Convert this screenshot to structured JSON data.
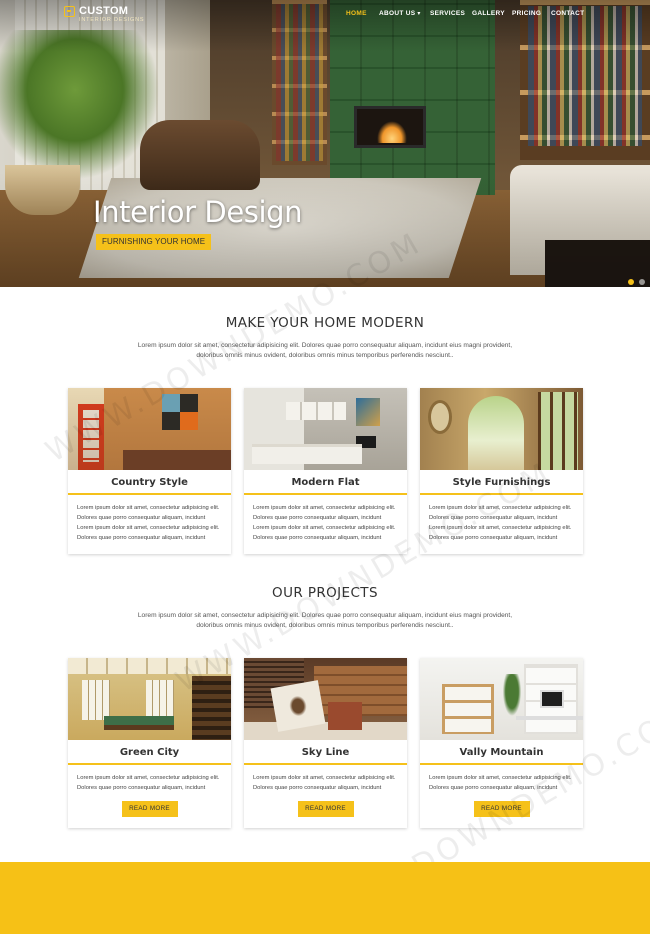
{
  "brand": {
    "name": "CUSTOM",
    "tagline": "INTERIOR DESIGNS",
    "accent_color": "#f5c11a"
  },
  "nav": {
    "items": [
      {
        "label": "HOME",
        "active": true
      },
      {
        "label": "ABOUT US",
        "has_dropdown": true,
        "active": false
      },
      {
        "label": "SERVICES",
        "active": false
      },
      {
        "label": "GALLERY",
        "active": false
      },
      {
        "label": "PRICING",
        "active": false
      },
      {
        "label": "CONTACT",
        "active": false
      }
    ],
    "dropdown_icon": "chevron-down-icon"
  },
  "hero": {
    "title": "Interior Design",
    "button_label": "FURNISHING YOUR HOME",
    "slides": 2,
    "active_slide": 1
  },
  "intro": {
    "title": "MAKE YOUR HOME MODERN",
    "text_line1": "Lorem ipsum dolor sit amet, consectetur adipisicing elit. Dolores quae porro consequatur aliquam, incidunt eius magni provident,",
    "text_line2": "doloribus omnis minus ovident, doloribus omnis minus temporibus perferendis nesciunt.."
  },
  "services": [
    {
      "title": "Country Style",
      "lines": [
        "Lorem ipsum dolor sit amet, consectetur adipisicing elit.",
        "Dolores quae porro consequatur aliquam, incidunt",
        "Lorem ipsum dolor sit amet, consectetur adipisicing elit.",
        "Dolores quae porro consequatur aliquam, incidunt"
      ]
    },
    {
      "title": "Modern Flat",
      "lines": [
        "Lorem ipsum dolor sit amet, consectetur adipisicing elit.",
        "Dolores quae porro consequatur aliquam, incidunt",
        "Lorem ipsum dolor sit amet, consectetur adipisicing elit.",
        "Dolores quae porro consequatur aliquam, incidunt"
      ]
    },
    {
      "title": "Style Furnishings",
      "lines": [
        "Lorem ipsum dolor sit amet, consectetur adipisicing elit.",
        "Dolores quae porro consequatur aliquam, incidunt",
        "Lorem ipsum dolor sit amet, consectetur adipisicing elit.",
        "Dolores quae porro consequatur aliquam, incidunt"
      ]
    }
  ],
  "projects_section": {
    "title": "OUR PROJECTS",
    "text_line1": "Lorem ipsum dolor sit amet, consectetur adipisicing elit. Dolores quae porro consequatur aliquam, incidunt eius magni provident,",
    "text_line2": "doloribus omnis minus ovident, doloribus omnis minus temporibus perferendis nesciunt.."
  },
  "projects": [
    {
      "title": "Green City",
      "lines": [
        "Lorem ipsum dolor sit amet, consectetur adipisicing elit.",
        "Dolores quae porro consequatur aliquam, incidunt"
      ],
      "button_label": "READ MORE"
    },
    {
      "title": "Sky Line",
      "lines": [
        "Lorem ipsum dolor sit amet, consectetur adipisicing elit.",
        "Dolores quae porro consequatur aliquam, incidunt"
      ],
      "button_label": "READ MORE"
    },
    {
      "title": "Vally Mountain",
      "lines": [
        "Lorem ipsum dolor sit amet, consectetur adipisicing elit.",
        "Dolores quae porro consequatur aliquam, incidunt"
      ],
      "button_label": "READ MORE"
    }
  ],
  "watermark": "WWW.DOWNDEMO.COM"
}
